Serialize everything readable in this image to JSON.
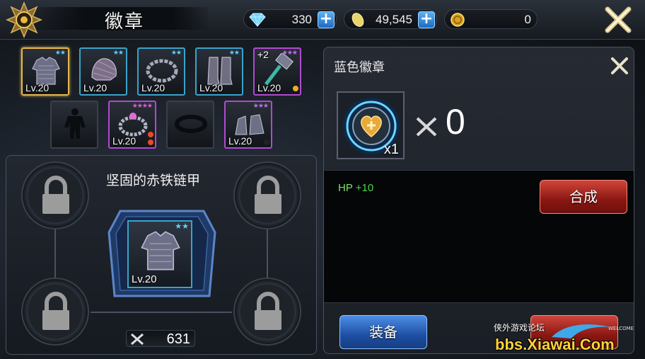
{
  "header": {
    "title": "徽章",
    "currencies": [
      {
        "icon": "diamond-icon",
        "value": "330"
      },
      {
        "icon": "stamina-icon",
        "value": "49,545"
      },
      {
        "icon": "gold-coin-icon",
        "value": "0"
      }
    ]
  },
  "inventory": {
    "row1": [
      {
        "level": "Lv.20",
        "rarity": "blue",
        "stars": "★★",
        "plus": "",
        "item": "chainmail-armor"
      },
      {
        "level": "Lv.20",
        "rarity": "blue",
        "stars": "★★",
        "plus": "",
        "item": "chainmail-helmet"
      },
      {
        "level": "Lv.20",
        "rarity": "blue",
        "stars": "★★",
        "plus": "",
        "item": "chain-necklace"
      },
      {
        "level": "Lv.20",
        "rarity": "blue",
        "stars": "★★",
        "plus": "",
        "item": "chainmail-boots"
      },
      {
        "level": "Lv.20",
        "rarity": "purple",
        "stars": "★★★",
        "plus": "+2",
        "item": "hammer-weapon"
      }
    ],
    "row2": [
      {
        "level": "",
        "rarity": "empty",
        "stars": "",
        "plus": "",
        "item": "body-silhouette"
      },
      {
        "level": "Lv.20",
        "rarity": "purple",
        "stars": "★★★★",
        "plus": "",
        "item": "ring"
      },
      {
        "level": "",
        "rarity": "empty",
        "stars": "",
        "plus": "",
        "item": "belt"
      },
      {
        "level": "Lv.20",
        "rarity": "purple",
        "stars": "★★★",
        "plus": "",
        "item": "chainmail-gauntlets"
      }
    ]
  },
  "equipment": {
    "item_name": "坚固的赤铁链甲",
    "item_level": "Lv.20",
    "item_stars": "★★",
    "power": "631"
  },
  "detail": {
    "title": "蓝色徽章",
    "badge_count": "x1",
    "owned": "0",
    "stat_key": "HP",
    "stat_value": "+10",
    "combine_label": "合成",
    "equip_label": "装备"
  },
  "watermark": {
    "line1": "侠外游戏论坛",
    "line2": "WELCOME",
    "line3": "bbs.Xiawai.Com"
  },
  "colors": {
    "blue_rarity": "#3aa3c9",
    "purple_rarity": "#b04ad0",
    "selected": "#e2b650",
    "stat_green": "#4ad64a"
  }
}
